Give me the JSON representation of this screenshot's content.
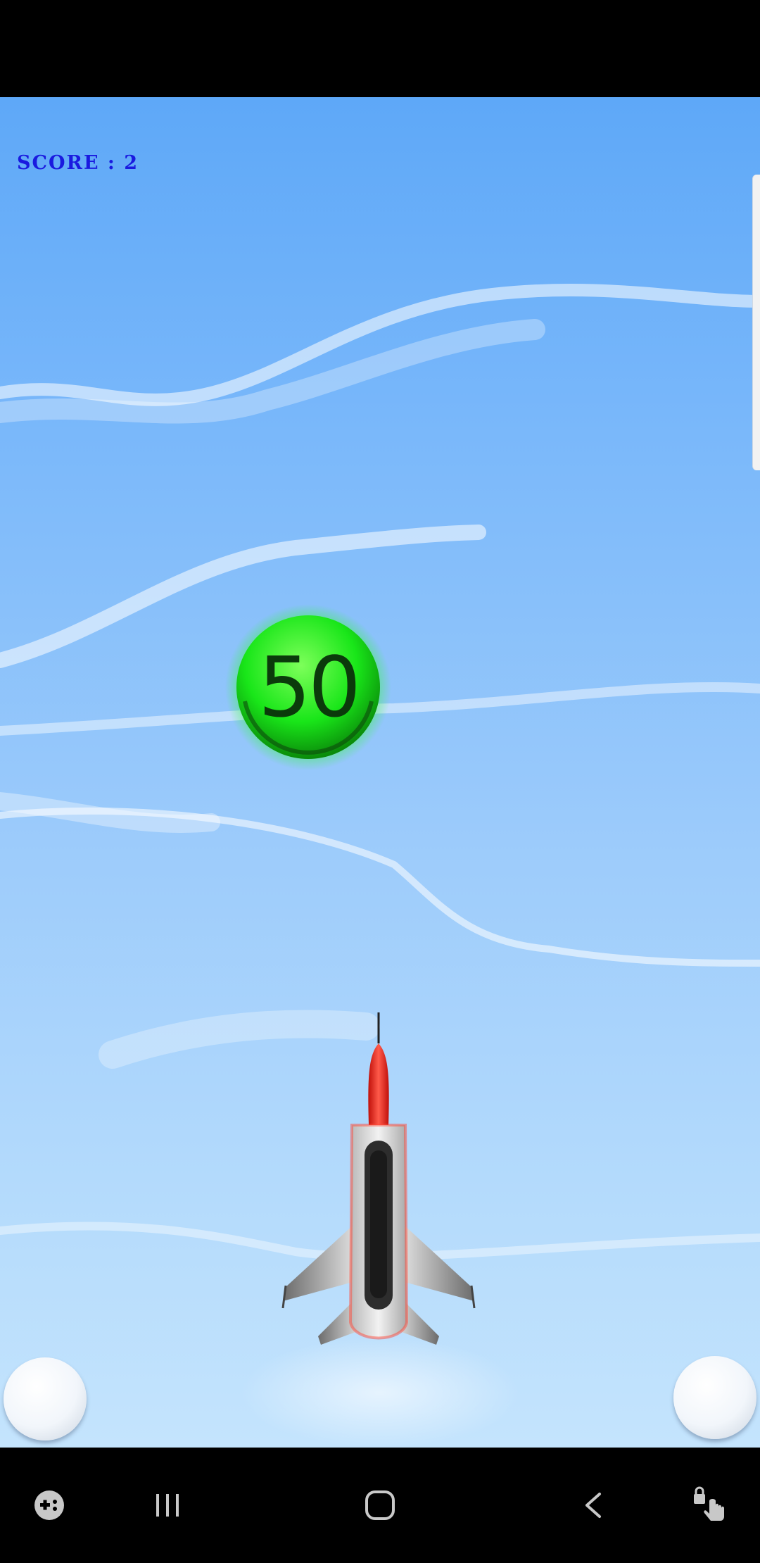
{
  "game": {
    "score_text": "SCORE : 2",
    "bonus_coin_value": "50"
  },
  "icons": {
    "jet": "fighter-jet-icon",
    "left_control": "left-control-button",
    "right_control": "right-control-button"
  },
  "navigation": {
    "items": [
      "game-tools-icon",
      "recent-apps-icon",
      "home-icon",
      "back-icon",
      "touch-lock-icon"
    ]
  },
  "colors": {
    "sky_top": "#5ea8f8",
    "sky_bottom": "#c4e4fd",
    "score_text": "#1a1adf",
    "coin_green": "#19e619",
    "jet_nose": "#ff2a1a"
  }
}
